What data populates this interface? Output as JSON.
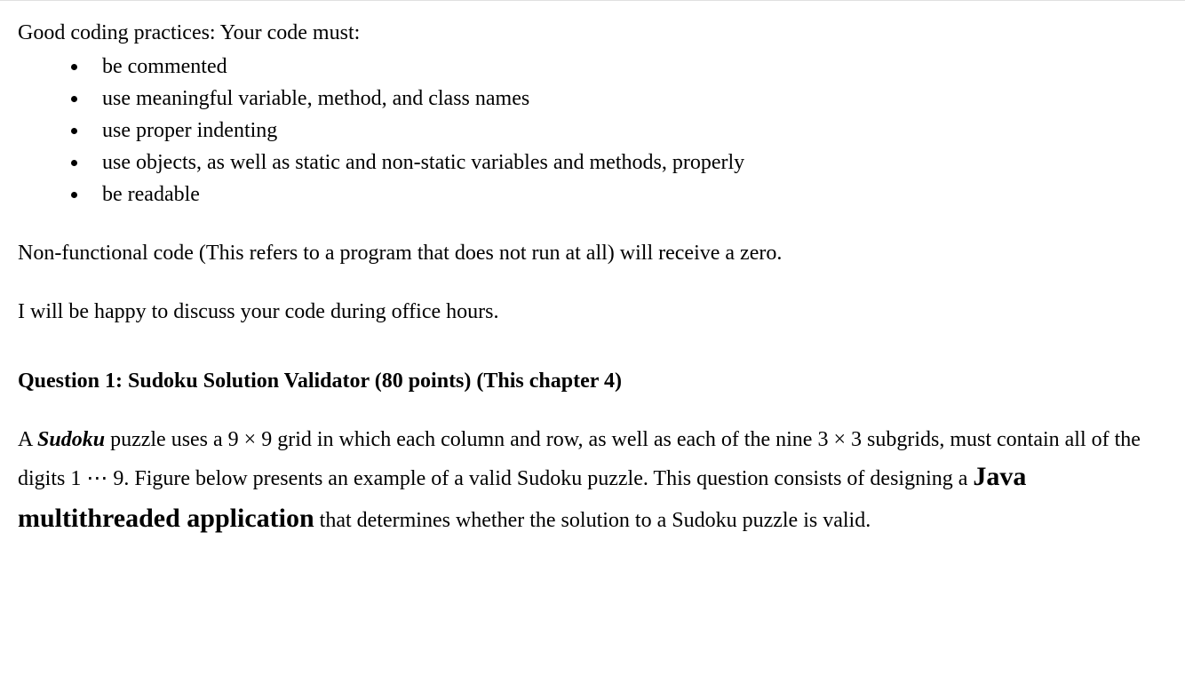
{
  "intro": "Good coding practices: Your code must:",
  "bullets": [
    "be commented",
    "use meaningful variable, method, and class names",
    "use proper indenting",
    "use objects, as well as static and non-static variables and methods, properly",
    "be readable"
  ],
  "nonfunctional": "Non-functional code (This refers to a program that does not run at all) will receive a zero.",
  "office_hours": "I will be happy to discuss your code during office hours.",
  "question_heading": "Question 1: Sudoku Solution Validator (80 points) (This chapter 4)",
  "q": {
    "a_prefix": "A ",
    "sudoku_word": "Sudoku",
    "part1": " puzzle uses a 9 × 9 grid in which each column and row, as well as each of the nine 3 × 3 subgrids, must contain all of the digits 1 ⋯ 9. Figure below presents an example of a valid Sudoku puzzle. This question consists of designing a ",
    "emph": "Java multithreaded application",
    "part2": " that determines whether the solution to a Sudoku puzzle is valid."
  }
}
